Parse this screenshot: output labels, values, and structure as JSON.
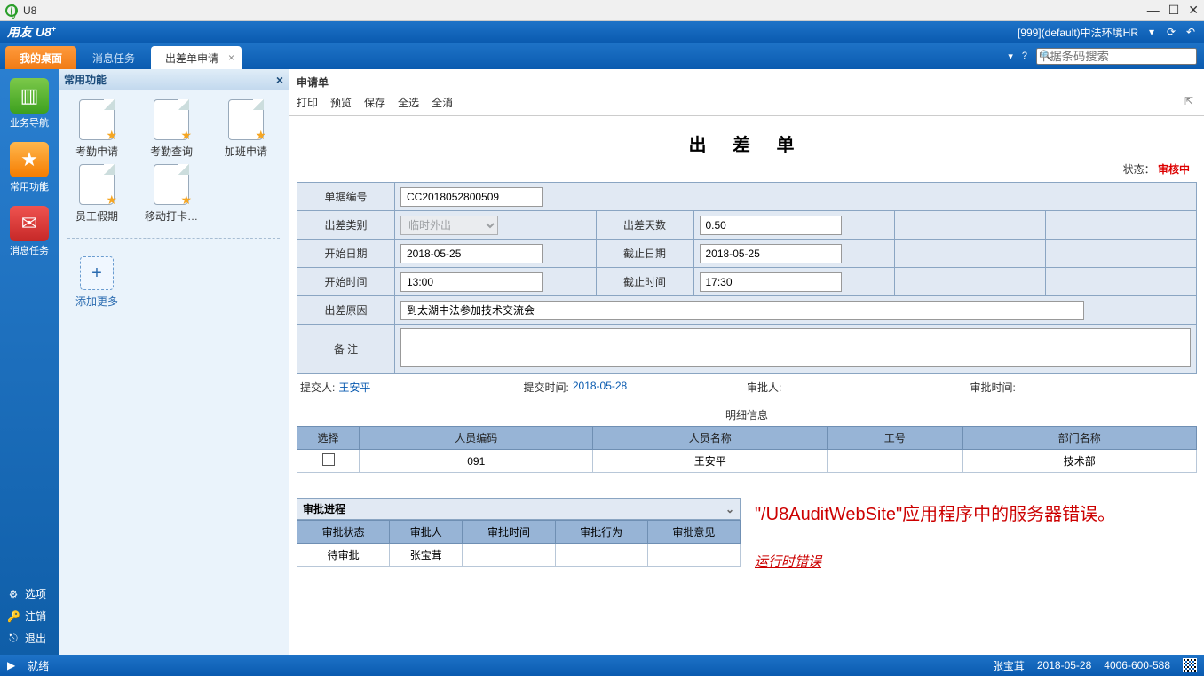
{
  "window": {
    "title": "U8"
  },
  "brand": {
    "name": "用友 U8",
    "sup": "+",
    "context": "[999](default)中法环境HR",
    "search_placeholder": "单据条码搜索"
  },
  "leftnav": {
    "items": [
      {
        "label": "业务导航"
      },
      {
        "label": "常用功能"
      },
      {
        "label": "消息任务"
      }
    ],
    "bottom": [
      {
        "label": "选项"
      },
      {
        "label": "注销"
      },
      {
        "label": "退出"
      }
    ]
  },
  "funcpanel": {
    "title": "常用功能",
    "items": [
      {
        "label": "考勤申请"
      },
      {
        "label": "考勤查询"
      },
      {
        "label": "加班申请"
      },
      {
        "label": "员工假期"
      },
      {
        "label": "移动打卡…"
      }
    ],
    "addmore": "添加更多"
  },
  "tabs": {
    "home": "我的桌面",
    "msg": "消息任务",
    "active": "出差单申请"
  },
  "doc": {
    "header": "申请单",
    "toolbar": {
      "print": "打印",
      "preview": "预览",
      "save": "保存",
      "selectall": "全选",
      "deselect": "全消"
    },
    "title": "出 差 单",
    "status_label": "状态：",
    "status_value": "审核中",
    "fields": {
      "doc_no_label": "单据编号",
      "doc_no": "CC2018052800509",
      "trip_type_label": "出差类别",
      "trip_type": "临时外出",
      "trip_days_label": "出差天数",
      "trip_days": "0.50",
      "start_date_label": "开始日期",
      "start_date": "2018-05-25",
      "end_date_label": "截止日期",
      "end_date": "2018-05-25",
      "start_time_label": "开始时间",
      "start_time": "13:00",
      "end_time_label": "截止时间",
      "end_time": "17:30",
      "reason_label": "出差原因",
      "reason": "到太湖中法参加技术交流会",
      "remark_label": "备    注",
      "remark": ""
    },
    "meta": {
      "submitter_label": "提交人:",
      "submitter": "王安平",
      "submit_time_label": "提交时间:",
      "submit_time": "2018-05-28",
      "approver_label": "审批人:",
      "approver": "",
      "approve_time_label": "审批时间:",
      "approve_time": ""
    },
    "detail": {
      "title": "明细信息",
      "cols": {
        "select": "选择",
        "emp_code": "人员编码",
        "emp_name": "人员名称",
        "job_no": "工号",
        "dept": "部门名称"
      },
      "rows": [
        {
          "emp_code": "091",
          "emp_name": "王安平",
          "job_no": "",
          "dept": "技术部"
        }
      ]
    },
    "approval": {
      "title": "审批进程",
      "cols": {
        "status": "审批状态",
        "person": "审批人",
        "time": "审批时间",
        "action": "审批行为",
        "opinion": "审批意见"
      },
      "rows": [
        {
          "status": "待审批",
          "person": "张宝茸",
          "time": "",
          "action": "",
          "opinion": ""
        }
      ]
    },
    "error": {
      "line1": "\"/U8AuditWebSite\"应用程序中的服务器错误。",
      "line2": "运行时错误"
    }
  },
  "statusbar": {
    "ready": "就绪",
    "user": "张宝茸",
    "date": "2018-05-28",
    "phone": "4006-600-588"
  }
}
